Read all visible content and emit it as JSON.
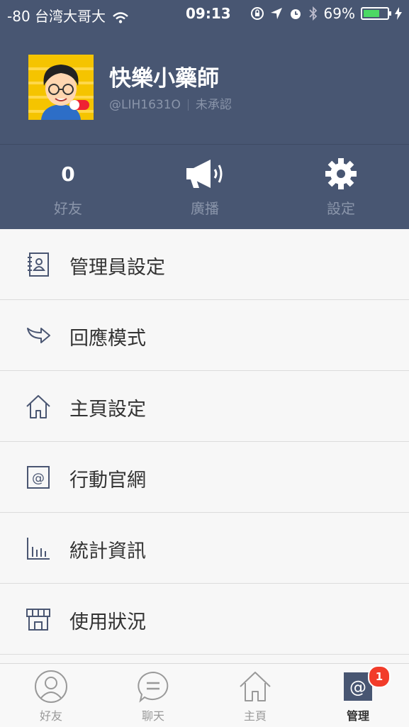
{
  "status_bar": {
    "carrier": "-80 台湾大哥大",
    "time": "09:13",
    "battery": "69%",
    "battery_level": 0.69,
    "icons": [
      "wifi-icon",
      "lock-rotation-icon",
      "location-arrow-icon",
      "alarm-icon",
      "bluetooth-icon",
      "battery-icon",
      "charging-bolt-icon"
    ]
  },
  "profile": {
    "name": "快樂小藥師",
    "id": "@LIH1631O",
    "status": "未承認"
  },
  "stats": [
    {
      "value": "0",
      "label": "好友"
    },
    {
      "icon": "megaphone-icon",
      "label": "廣播"
    },
    {
      "icon": "gear-icon",
      "label": "設定"
    }
  ],
  "menu": [
    {
      "label": "管理員設定",
      "icon": "contact-book-icon"
    },
    {
      "label": "回應模式",
      "icon": "reply-arrow-icon"
    },
    {
      "label": "主頁設定",
      "icon": "home-icon"
    },
    {
      "label": "行動官網",
      "icon": "at-sign-icon"
    },
    {
      "label": "統計資訊",
      "icon": "bar-chart-icon"
    },
    {
      "label": "使用狀況",
      "icon": "storefront-icon"
    }
  ],
  "tabs": [
    {
      "label": "好友",
      "icon": "person-icon"
    },
    {
      "label": "聊天",
      "icon": "chat-bubble-icon"
    },
    {
      "label": "主頁",
      "icon": "home-icon"
    },
    {
      "label": "管理",
      "icon": "at-sign-icon",
      "badge": "1",
      "active": true
    }
  ],
  "colors": {
    "header": "#485672",
    "badge": "#f23c2a",
    "icon": "#4a5672"
  }
}
